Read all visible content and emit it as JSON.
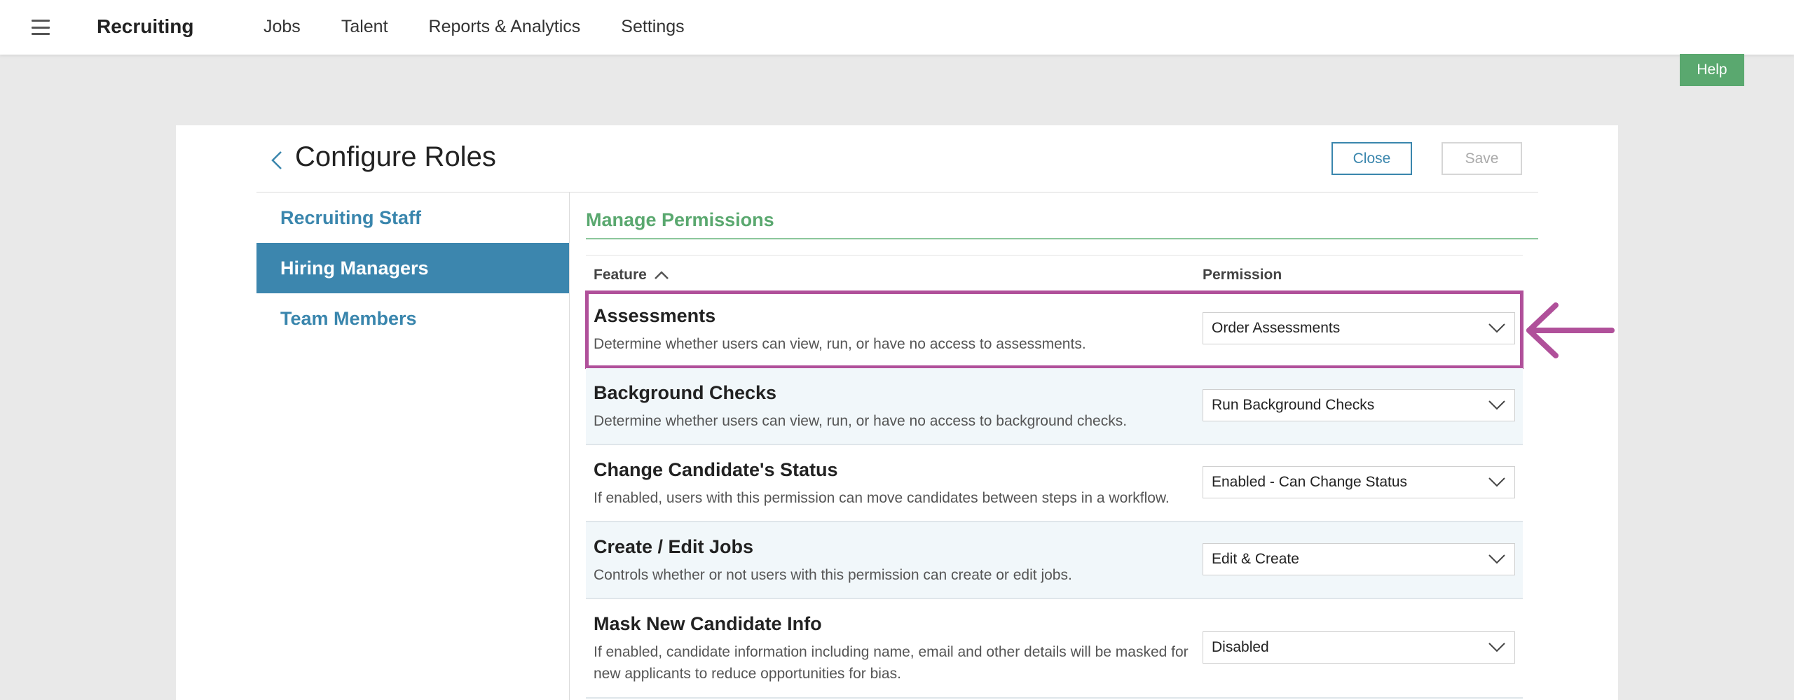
{
  "app": {
    "brand": "Recruiting",
    "nav": [
      "Jobs",
      "Talent",
      "Reports & Analytics",
      "Settings"
    ],
    "help_label": "Help"
  },
  "page": {
    "title": "Configure Roles",
    "close_label": "Close",
    "save_label": "Save"
  },
  "sidebar": {
    "items": [
      {
        "label": "Recruiting Staff",
        "active": false
      },
      {
        "label": "Hiring Managers",
        "active": true
      },
      {
        "label": "Team Members",
        "active": false
      }
    ]
  },
  "permissions": {
    "section_title": "Manage Permissions",
    "col_feature": "Feature",
    "col_permission": "Permission",
    "rows": [
      {
        "name": "Assessments",
        "desc": "Determine whether users can view, run, or have no access to assessments.",
        "value": "Order Assessments"
      },
      {
        "name": "Background Checks",
        "desc": "Determine whether users can view, run, or have no access to background checks.",
        "value": "Run Background Checks"
      },
      {
        "name": "Change Candidate's Status",
        "desc": "If enabled, users with this permission can move candidates between steps in a workflow.",
        "value": "Enabled - Can Change Status"
      },
      {
        "name": "Create / Edit Jobs",
        "desc": "Controls whether or not users with this permission can create or edit jobs.",
        "value": "Edit & Create"
      },
      {
        "name": "Mask New Candidate Info",
        "desc": "If enabled, candidate information including name, email and other details will be masked for new applicants to reduce opportunities for bias.",
        "value": "Disabled"
      }
    ]
  },
  "colors": {
    "accent_blue": "#3a86ad",
    "accent_green": "#5aa86f",
    "annotation_magenta": "#b0509a"
  }
}
